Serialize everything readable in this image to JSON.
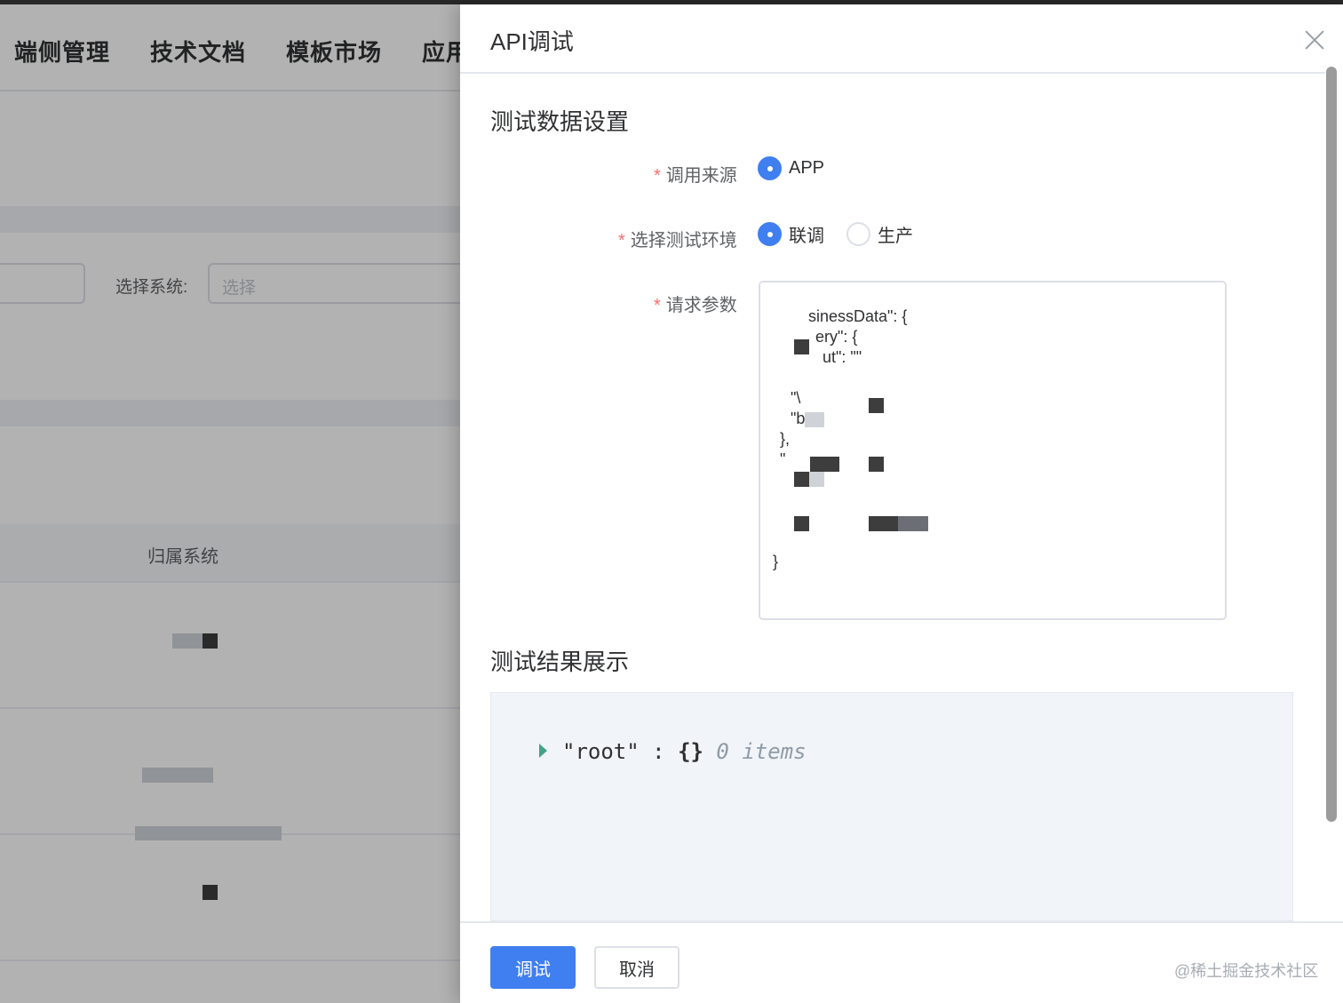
{
  "background": {
    "nav": [
      "端侧管理",
      "技术文档",
      "模板市场",
      "应用"
    ],
    "filter_label": "选择系统:",
    "filter_placeholder": "选择",
    "table_header": "归属系统"
  },
  "drawer": {
    "title": "API调试",
    "section_settings": "测试数据设置",
    "source_label": "调用来源",
    "source_option": "APP",
    "env_label": "选择测试环境",
    "env_options": [
      "联调",
      "生产"
    ],
    "env_selected": "联调",
    "params_label": "请求参数",
    "params_lines": [
      "sinessData\": {",
      "ery\": {",
      "ut\": \"\"",
      "\"\\",
      "\"b",
      "},",
      "\"",
      "}"
    ],
    "section_result": "测试结果展示",
    "result": {
      "key": "\"root\"",
      "colon": ":",
      "brace": "{}",
      "count": "0 items"
    },
    "buttons": {
      "debug": "调试",
      "cancel": "取消"
    }
  },
  "watermark": "@稀土掘金技术社区",
  "colors": {
    "primary": "#3f7ff0",
    "required": "#f56c6c",
    "caret": "#42a28c"
  }
}
